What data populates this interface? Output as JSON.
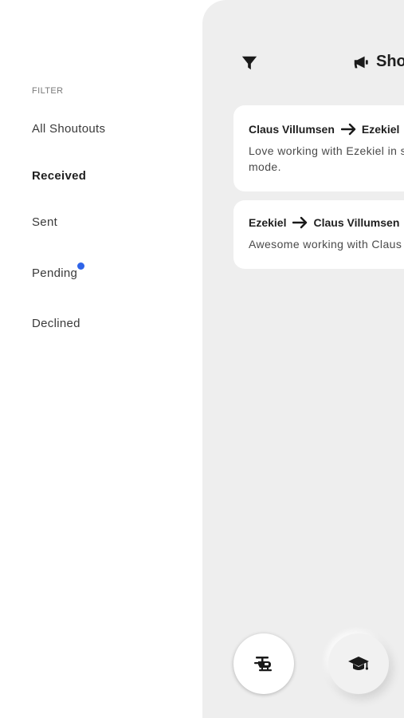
{
  "drawer": {
    "heading": "FILTER",
    "items": [
      {
        "label": "All Shoutouts",
        "active": false
      },
      {
        "label": "Received",
        "active": true
      },
      {
        "label": "Sent",
        "active": false
      },
      {
        "label": "Pending",
        "active": false,
        "has_badge": true
      },
      {
        "label": "Declined",
        "active": false
      }
    ],
    "badge_color": "#2f64e8"
  },
  "header": {
    "filter_icon": "funnel-icon",
    "title_icon": "megaphone-icon",
    "title": "Shoutouts"
  },
  "shoutouts": [
    {
      "from": "Claus Villumsen",
      "to": "Ezekiel",
      "message": "Love working with Ezekiel in ship mode."
    },
    {
      "from": "Ezekiel",
      "to": "Claus Villumsen",
      "message": "Awesome working with Claus"
    }
  ],
  "bottom_actions": [
    {
      "icon": "helicopter-icon",
      "selected": true
    },
    {
      "icon": "graduation-cap-icon",
      "selected": false
    }
  ],
  "colors": {
    "panel_bg": "#eeeeee",
    "card_bg": "#ffffff",
    "accent": "#2f64e8"
  }
}
